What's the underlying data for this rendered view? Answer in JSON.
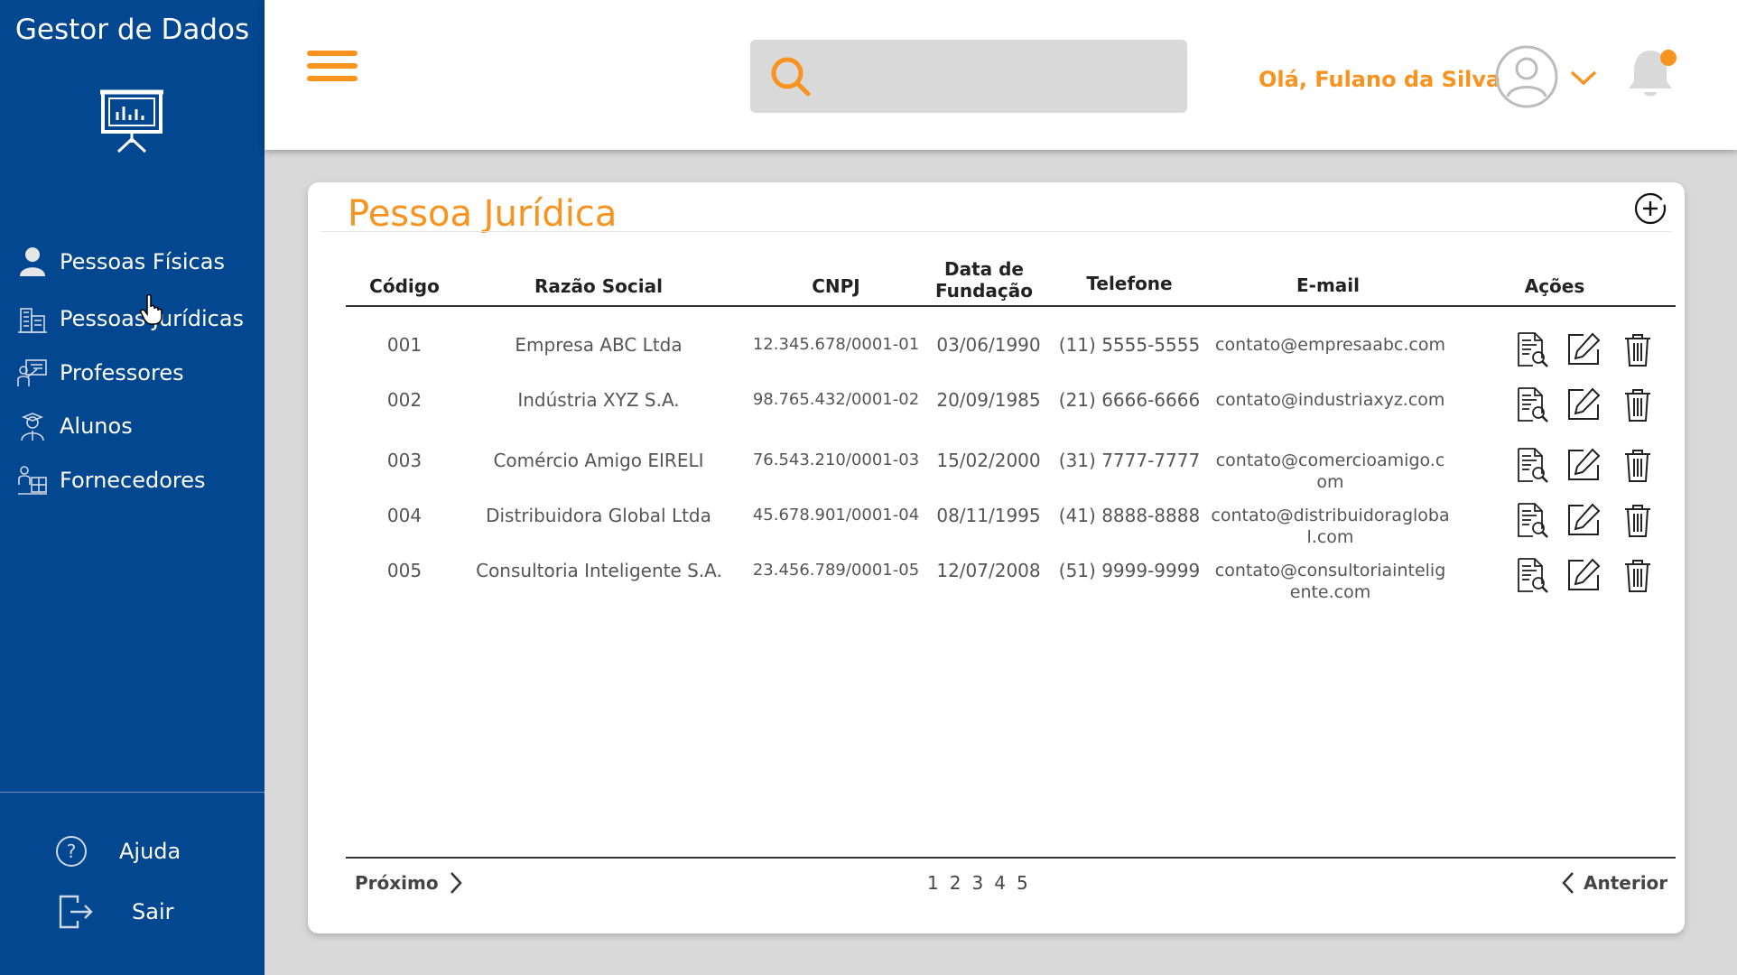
{
  "app": {
    "title": "Gestor de Dados"
  },
  "sidebar": {
    "items": [
      {
        "label": "Pessoas Físicas",
        "icon": "person-icon"
      },
      {
        "label": "Pessoas Jurídicas",
        "icon": "buildings-icon"
      },
      {
        "label": "Professores",
        "icon": "teacher-icon"
      },
      {
        "label": "Alunos",
        "icon": "student-icon"
      },
      {
        "label": "Fornecedores",
        "icon": "supplier-icon"
      }
    ],
    "help_label": "Ajuda",
    "logout_label": "Sair"
  },
  "header": {
    "search_value": "",
    "greeting": "Olá, Fulano da Silva"
  },
  "main": {
    "title": "Pessoa Jurídica",
    "columns": [
      "Código",
      "Razão Social",
      "CNPJ",
      "Data de Fundação",
      "Telefone",
      "E-mail",
      "Ações"
    ],
    "rows": [
      {
        "codigo": "001",
        "razao": "Empresa ABC Ltda",
        "cnpj": "12.345.678/0001-01",
        "data": "03/06/1990",
        "telefone": "(11) 5555-5555",
        "email": "contato@empresaabc.com"
      },
      {
        "codigo": "002",
        "razao": "Indústria XYZ S.A.",
        "cnpj": "98.765.432/0001-02",
        "data": "20/09/1985",
        "telefone": "(21) 6666-6666",
        "email": "contato@industriaxyz.com"
      },
      {
        "codigo": "003",
        "razao": "Comércio Amigo EIRELI",
        "cnpj": "76.543.210/0001-03",
        "data": "15/02/2000",
        "telefone": "(31) 7777-7777",
        "email": "contato@comercioamigo.com"
      },
      {
        "codigo": "004",
        "razao": "Distribuidora Global Ltda",
        "cnpj": "45.678.901/0001-04",
        "data": "08/11/1995",
        "telefone": "(41) 8888-8888",
        "email": "contato@distribuidoraglobal.com"
      },
      {
        "codigo": "005",
        "razao": "Consultoria Inteligente S.A.",
        "cnpj": "23.456.789/0001-05",
        "data": "12/07/2008",
        "telefone": "(51) 9999-9999",
        "email": "contato@consultoriainteligente.com"
      }
    ],
    "pagination": {
      "next_label": "Próximo",
      "prev_label": "Anterior",
      "pages": [
        "1",
        "2",
        "3",
        "4",
        "5"
      ]
    }
  },
  "colors": {
    "sidebar": "#02478f",
    "accent": "#f7931e",
    "background": "#d9d9d9"
  }
}
